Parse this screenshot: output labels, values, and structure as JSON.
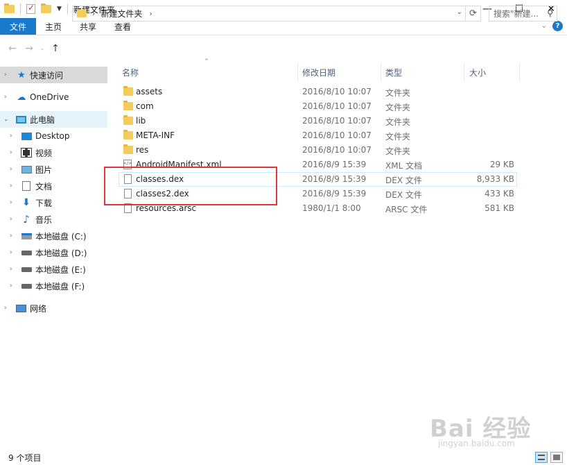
{
  "window": {
    "title": "新建文件夹",
    "minimize": "—",
    "maximize": "☐",
    "close": "✕"
  },
  "ribbon": {
    "tabs": [
      "文件",
      "主页",
      "共享",
      "查看"
    ],
    "help": "?"
  },
  "address": {
    "path": "新建文件夹",
    "search_placeholder": "搜索\"新建..."
  },
  "sidebar": {
    "items": [
      {
        "label": "快速访问",
        "icon": "star-icon"
      },
      {
        "label": "OneDrive",
        "icon": "cloud-icon"
      },
      {
        "label": "此电脑",
        "icon": "computer-icon"
      },
      {
        "label": "Desktop",
        "icon": "desktop-icon"
      },
      {
        "label": "视频",
        "icon": "video-icon"
      },
      {
        "label": "图片",
        "icon": "picture-icon"
      },
      {
        "label": "文档",
        "icon": "document-icon"
      },
      {
        "label": "下载",
        "icon": "download-icon"
      },
      {
        "label": "音乐",
        "icon": "music-icon"
      },
      {
        "label": "本地磁盘 (C:)",
        "icon": "drive-c-icon"
      },
      {
        "label": "本地磁盘 (D:)",
        "icon": "drive-icon"
      },
      {
        "label": "本地磁盘 (E:)",
        "icon": "drive-icon"
      },
      {
        "label": "本地磁盘 (F:)",
        "icon": "drive-icon"
      },
      {
        "label": "网络",
        "icon": "network-icon"
      }
    ]
  },
  "columns": {
    "name": "名称",
    "date": "修改日期",
    "type": "类型",
    "size": "大小"
  },
  "files": [
    {
      "name": "assets",
      "date": "2016/8/10 10:07",
      "type": "文件夹",
      "size": "",
      "icon": "folder-icon"
    },
    {
      "name": "com",
      "date": "2016/8/10 10:07",
      "type": "文件夹",
      "size": "",
      "icon": "folder-icon"
    },
    {
      "name": "lib",
      "date": "2016/8/10 10:07",
      "type": "文件夹",
      "size": "",
      "icon": "folder-icon"
    },
    {
      "name": "META-INF",
      "date": "2016/8/10 10:07",
      "type": "文件夹",
      "size": "",
      "icon": "folder-icon"
    },
    {
      "name": "res",
      "date": "2016/8/10 10:07",
      "type": "文件夹",
      "size": "",
      "icon": "folder-icon"
    },
    {
      "name": "AndroidManifest.xml",
      "date": "2016/8/9 15:39",
      "type": "XML 文档",
      "size": "29 KB",
      "icon": "xml-file-icon"
    },
    {
      "name": "classes.dex",
      "date": "2016/8/9 15:39",
      "type": "DEX 文件",
      "size": "8,933 KB",
      "icon": "file-icon"
    },
    {
      "name": "classes2.dex",
      "date": "2016/8/9 15:39",
      "type": "DEX 文件",
      "size": "433 KB",
      "icon": "file-icon"
    },
    {
      "name": "resources.arsc",
      "date": "1980/1/1 8:00",
      "type": "ARSC 文件",
      "size": "581 KB",
      "icon": "file-icon"
    }
  ],
  "status": {
    "count": "9 个项目"
  },
  "watermark": {
    "main": "Bai 经验",
    "sub": "jingyan.baidu.com"
  }
}
